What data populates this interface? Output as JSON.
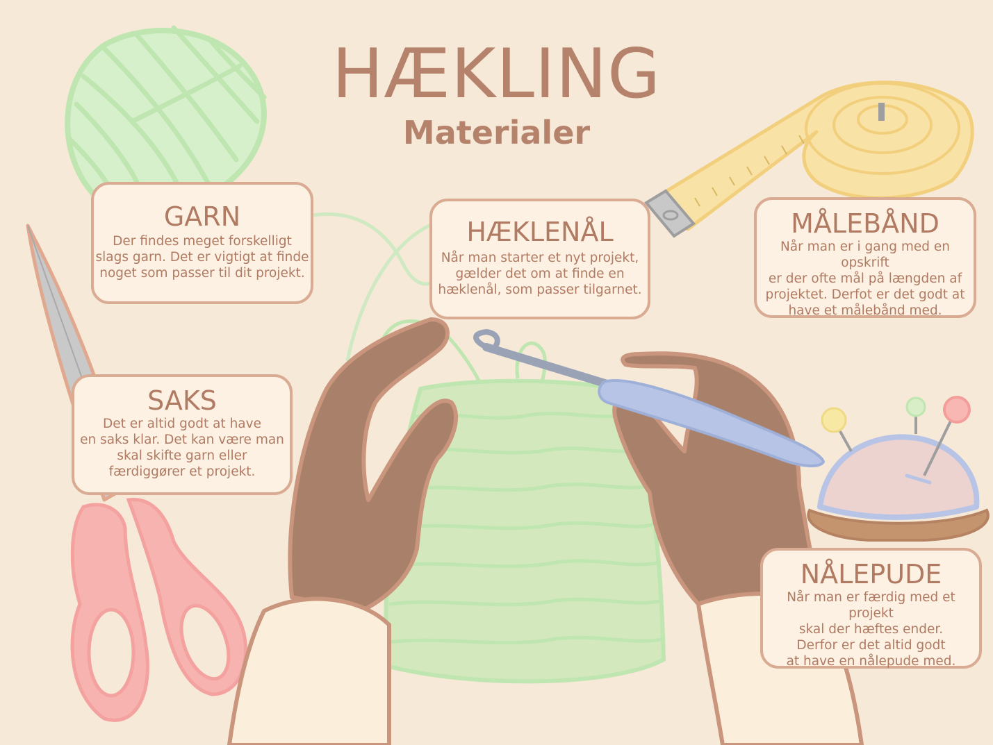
{
  "title": "HÆKLING",
  "subtitle": "Materialer",
  "cards": {
    "garn": {
      "heading": "GARN",
      "text": "Der findes meget forskelligt\nslags garn. Det er vigtigt at finde\nnoget som passer til dit projekt."
    },
    "haeklenaal": {
      "heading": "HÆKLENÅL",
      "text": "Når man starter et nyt projekt,\ngælder det om at finde en\nhæklenål, som passer tilgarnet."
    },
    "maalebaand": {
      "heading": "MÅLEBÅND",
      "text": "Når man er i gang med en opskrift\ner der ofte mål på længden af\nprojektet. Derfot er det godt at\nhave et målebånd med."
    },
    "saks": {
      "heading": "SAKS",
      "text": "Det er altid godt at have\nen saks klar. Det kan være man\nskal skifte garn eller\nfærdiggører et projekt."
    },
    "naalepude": {
      "heading": "NÅLEPUDE",
      "text": "Når man er færdig med et projekt\nskal der hæftes ender.\nDerfor er det altid godt\nat have en nålepude med."
    }
  },
  "colors": {
    "background": "#f7e9d8",
    "text": "#b07a63",
    "card_border": "#d9ab92",
    "yarn_green": "#bfe6b0",
    "skin": "#a9806a",
    "scissors_pink": "#f6b3b0",
    "tape_yellow": "#f9e2a6",
    "hook_blue": "#b7c4e6"
  },
  "icons": [
    "yarn-ball-icon",
    "scissors-icon",
    "measuring-tape-icon",
    "pincushion-icon",
    "crochet-hook-icon",
    "hands-illustration"
  ]
}
